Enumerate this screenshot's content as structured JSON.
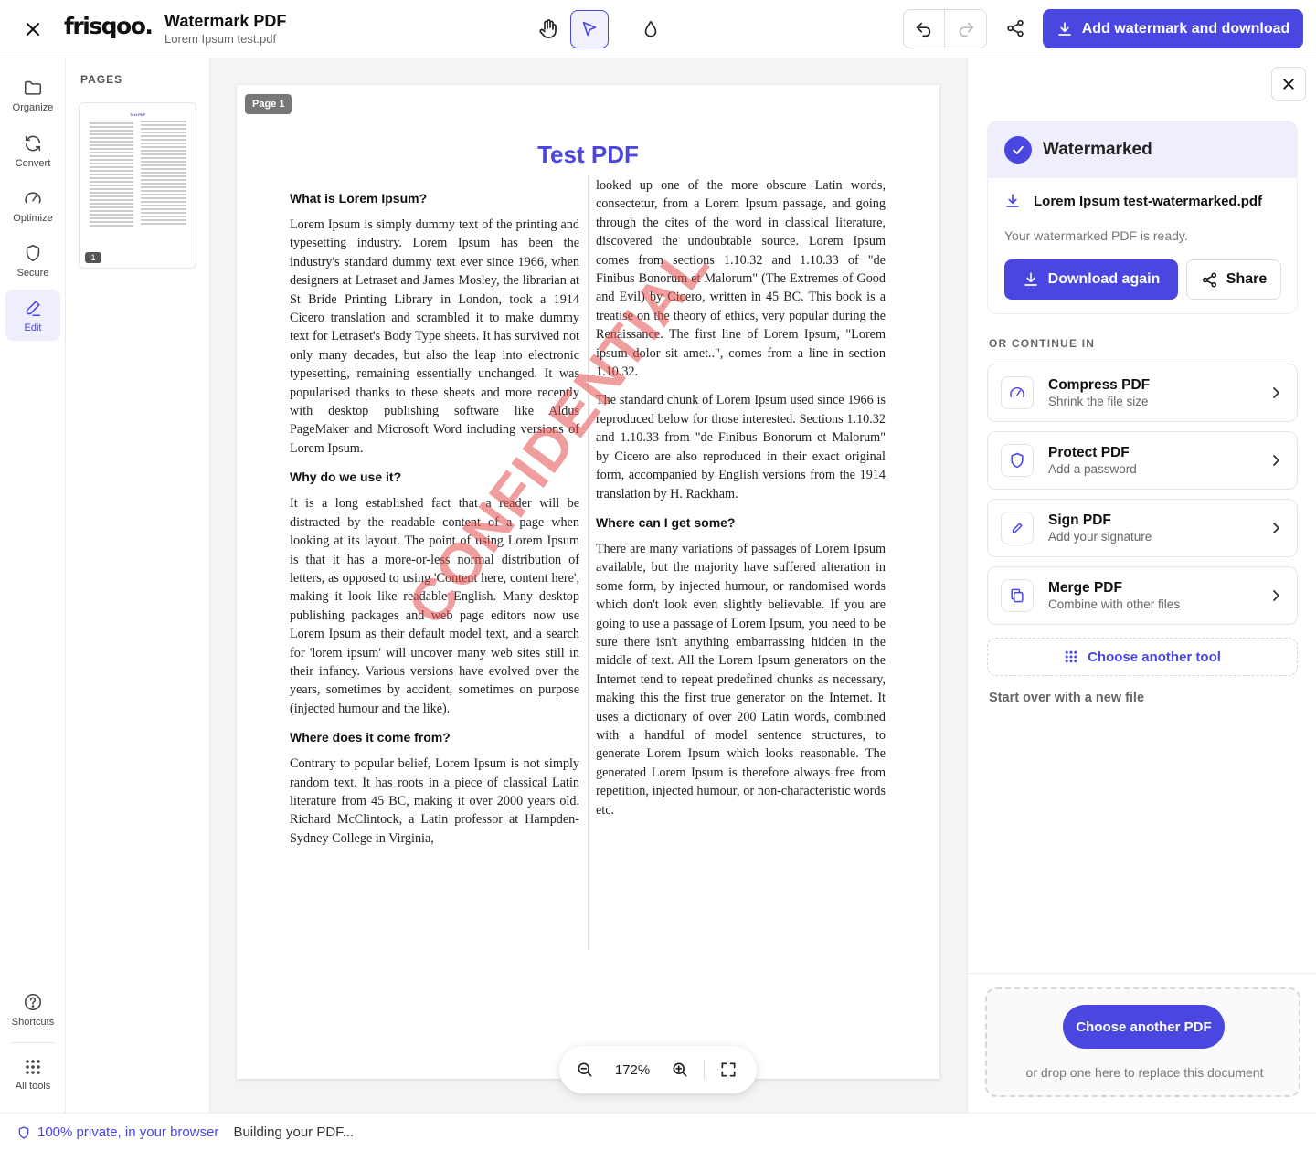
{
  "topbar": {
    "logo": "frisqoo.",
    "title": "Watermark PDF",
    "file_name": "Lorem Ipsum test.pdf",
    "primary_action": "Add watermark and download"
  },
  "rail": {
    "items": [
      {
        "label": "Organize",
        "icon": "folder-icon"
      },
      {
        "label": "Convert",
        "icon": "refresh-icon"
      },
      {
        "label": "Optimize",
        "icon": "gauge-icon"
      },
      {
        "label": "Secure",
        "icon": "shield-icon"
      },
      {
        "label": "Edit",
        "icon": "pen-icon",
        "active": true
      }
    ],
    "shortcuts": "Shortcuts",
    "all_tools": "All tools"
  },
  "pages_panel": {
    "heading": "PAGES",
    "thumb_title": "Test PDF",
    "page_number": "1"
  },
  "document": {
    "page_tag": "Page 1",
    "title": "Test PDF",
    "watermark": "CONFIDENTIAL",
    "sections": {
      "s1_heading": "What is Lorem Ipsum?",
      "s1_body": "Lorem Ipsum is simply dummy text of the printing and typesetting industry. Lorem Ipsum has been the industry's standard dummy text ever since 1966, when designers at Letraset and James Mosley, the librarian at St Bride Printing Library in London, took a 1914 Cicero translation and scrambled it to make dummy text for Letraset's Body Type sheets. It has survived not only many decades, but also the leap into electronic typesetting, remaining essentially unchanged. It was popularised thanks to these sheets and more recently with desktop publishing software like Aldus PageMaker and Microsoft Word including versions of Lorem Ipsum.",
      "s2_heading": "Why do we use it?",
      "s2_body": "It is a long established fact that a reader will be distracted by the readable content of a page when looking at its layout. The point of using Lorem Ipsum is that it has a more-or-less normal distribution of letters, as opposed to using 'Content here, content here', making it look like readable English. Many desktop publishing packages and web page editors now use Lorem Ipsum as their default model text, and a search for 'lorem ipsum' will uncover many web sites still in their infancy. Various versions have evolved over the years, sometimes by accident, sometimes on purpose (injected humour and the like).",
      "s3_heading": "Where does it come from?",
      "s3_body": "Contrary to popular belief, Lorem Ipsum is not simply random text. It has roots in a piece of classical Latin literature from 45 BC, making it over 2000 years old. Richard McClintock, a Latin professor at Hampden-Sydney College in Virginia,",
      "s3_cont": "looked up one of the more obscure Latin words, consectetur, from a Lorem Ipsum passage, and going through the cites of the word in classical literature, discovered the undoubtable source. Lorem Ipsum comes from sections 1.10.32 and 1.10.33 of \"de Finibus Bonorum et Malorum\" (The Extremes of Good and Evil) by Cicero, written in 45 BC. This book is a treatise on the theory of ethics, very popular during the Renaissance. The first line of Lorem Ipsum, \"Lorem ipsum dolor sit amet..\", comes from a line in section 1.10.32.",
      "s3_p2": "The standard chunk of Lorem Ipsum used since 1966 is reproduced below for those interested. Sections 1.10.32 and 1.10.33 from \"de Finibus Bonorum et Malorum\" by Cicero are also reproduced in their exact original form, accompanied by English versions from the 1914 translation by H. Rackham.",
      "s4_heading": "Where can I get some?",
      "s4_body": "There are many variations of passages of Lorem Ipsum available, but the majority have suffered alteration in some form, by injected humour, or randomised words which don't look even slightly believable. If you are going to use a passage of Lorem Ipsum, you need to be sure there isn't anything embarrassing hidden in the middle of text. All the Lorem Ipsum generators on the Internet tend to repeat predefined chunks as necessary, making this the first true generator on the Internet. It uses a dictionary of over 200 Latin words, combined with a handful of model sentence structures, to generate Lorem Ipsum which looks reasonable. The generated Lorem Ipsum is therefore always free from repetition, injected humour, or non-characteristic words etc."
    }
  },
  "zoom": {
    "value": "172%"
  },
  "result": {
    "title": "Watermarked",
    "file": "Lorem Ipsum test-watermarked.pdf",
    "ready": "Your watermarked PDF is ready.",
    "download_again": "Download again",
    "share": "Share"
  },
  "continue": {
    "heading": "OR CONTINUE IN",
    "tools": [
      {
        "title": "Compress PDF",
        "sub": "Shrink the file size",
        "icon": "gauge-icon"
      },
      {
        "title": "Protect PDF",
        "sub": "Add a password",
        "icon": "shield-icon"
      },
      {
        "title": "Sign PDF",
        "sub": "Add your signature",
        "icon": "pen-icon"
      },
      {
        "title": "Merge PDF",
        "sub": "Combine with other files",
        "icon": "copy-icon"
      }
    ],
    "choose_another_tool": "Choose another tool",
    "start_over": "Start over with a new file"
  },
  "drop": {
    "button": "Choose another PDF",
    "hint": "or drop one here to replace this document"
  },
  "status": {
    "private": "100% private, in your browser",
    "building": "Building your PDF..."
  },
  "colors": {
    "accent": "#4a47e0",
    "watermark": "#e24c4c"
  }
}
